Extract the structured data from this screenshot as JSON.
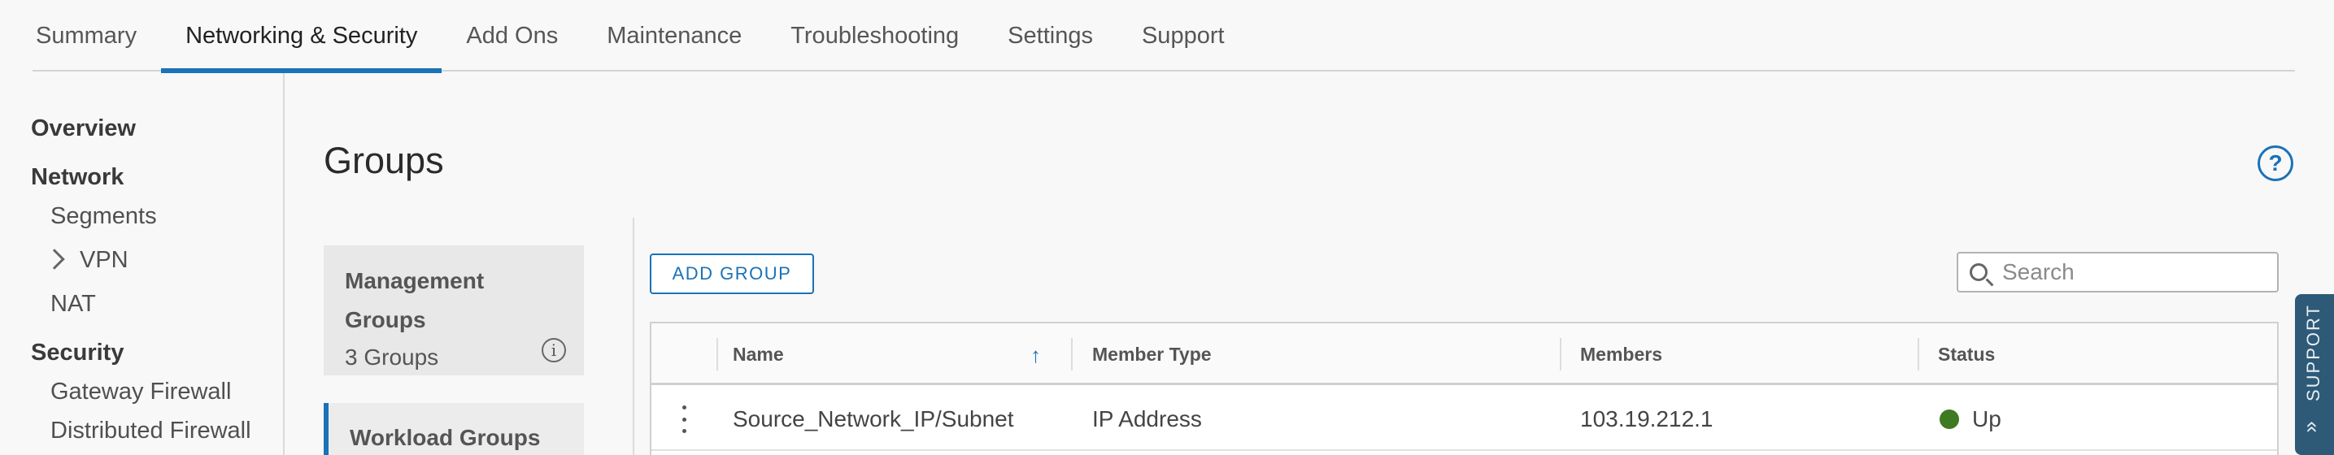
{
  "tabs": [
    "Summary",
    "Networking & Security",
    "Add Ons",
    "Maintenance",
    "Troubleshooting",
    "Settings",
    "Support"
  ],
  "active_tab": "Networking & Security",
  "sidenav": {
    "overview": "Overview",
    "network": "Network",
    "segments": "Segments",
    "vpn": "VPN",
    "nat": "NAT",
    "security": "Security",
    "gateway_firewall": "Gateway Firewall",
    "distributed_firewall": "Distributed Firewall"
  },
  "page": {
    "title": "Groups",
    "help_icon": "?"
  },
  "cards": {
    "management_title_line1": "Management",
    "management_title_line2": "Groups",
    "management_count": "3 Groups",
    "info_icon": "i",
    "workload_title": "Workload Groups"
  },
  "toolbar": {
    "add_group": "ADD GROUP",
    "search_placeholder": "Search"
  },
  "grid": {
    "columns": [
      "Name",
      "Member Type",
      "Members",
      "Status"
    ],
    "rows": [
      {
        "name": "Source_Network_IP/Subnet",
        "member_type": "IP Address",
        "members": "103.19.212.1",
        "status": "Up"
      }
    ]
  },
  "colors": {
    "accent": "#1a72b8",
    "status_up": "#3d7a22",
    "support_tab": "#2e5a78"
  },
  "support_tab": {
    "label": "SUPPORT",
    "icon": "double-chevron-up-icon"
  }
}
